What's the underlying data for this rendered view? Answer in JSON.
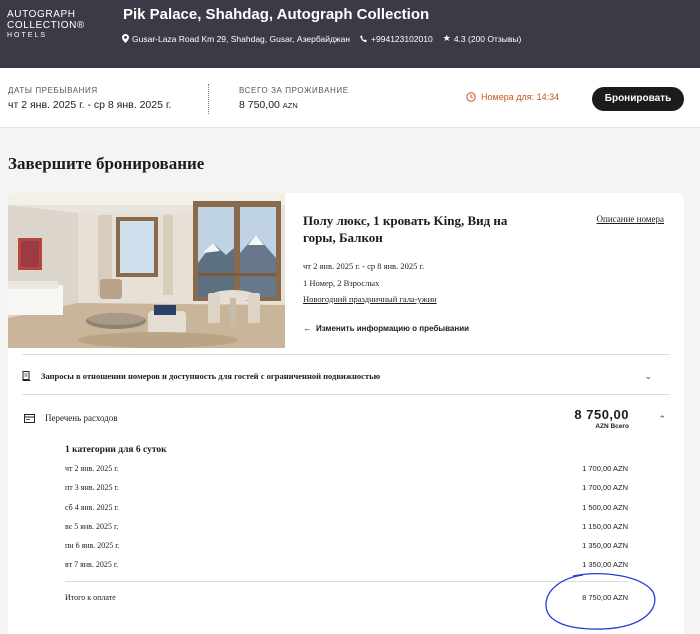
{
  "header": {
    "logo_line1": "AUTOGRAPH",
    "logo_line2": "COLLECTION®",
    "logo_line3": "HOTELS",
    "hotel_name": "Pik Palace, Shahdag, Autograph Collection",
    "address": "Gusar-Laza Road Km 29, Shahdag, Gusar, Азербайджан",
    "phone": "+994123102010",
    "rating": "4.3 (200 Отзывы)"
  },
  "summary": {
    "dates_label": "ДАТЫ ПРЕБЫВАНИЯ",
    "dates_value": "чт 2 янв. 2025 г. - ср 8 янв. 2025 г.",
    "total_label": "ВСЕГО ЗА ПРОЖИВАНИЕ",
    "total_value": "8 750,00",
    "total_currency": "AZN",
    "timer": "Номера для: 14:34",
    "book_button": "Бронировать"
  },
  "page_title": "Завершите бронирование",
  "room": {
    "title": "Полу люкс, 1 кровать King, Вид на горы, Балкон",
    "description_link": "Описание номера",
    "dates": "чт 2 янв. 2025 г. - ср 8 янв. 2025 г.",
    "occupancy": "1 Номер, 2 Взрослых",
    "package": "Новогодний праздничный гала-ужин",
    "change_link": "Изменить информацию о пребывании"
  },
  "accessibility": {
    "label": "Запросы в отношении номеров и доступность для гостей с ограниченной подвижностью"
  },
  "expenses": {
    "label": "Перечень расходов",
    "total": "8  750,00",
    "total_sub": "AZN Всего",
    "category": "1 категории для 6 суток",
    "nights": [
      {
        "date": "чт 2 янв. 2025 г.",
        "price": "1  700,00 AZN"
      },
      {
        "date": "пт 3 янв. 2025 г.",
        "price": "1  700,00 AZN"
      },
      {
        "date": "сб 4 янв. 2025 г.",
        "price": "1  500,00 AZN"
      },
      {
        "date": "вс 5 янв. 2025 г.",
        "price": "1  150,00 AZN"
      },
      {
        "date": "пн 6 янв. 2025 г.",
        "price": "1  350,00 AZN"
      },
      {
        "date": "вт 7 янв. 2025 г.",
        "price": "1  350,00 AZN"
      }
    ],
    "total_payable_label": "Итого к оплате",
    "total_payable": "8  750,00 AZN"
  },
  "colors": {
    "header_bg": "#3c3b45",
    "accent_orange": "#c4561b",
    "button_bg": "#1c1c1c",
    "annotation_blue": "#2a3ad6"
  }
}
